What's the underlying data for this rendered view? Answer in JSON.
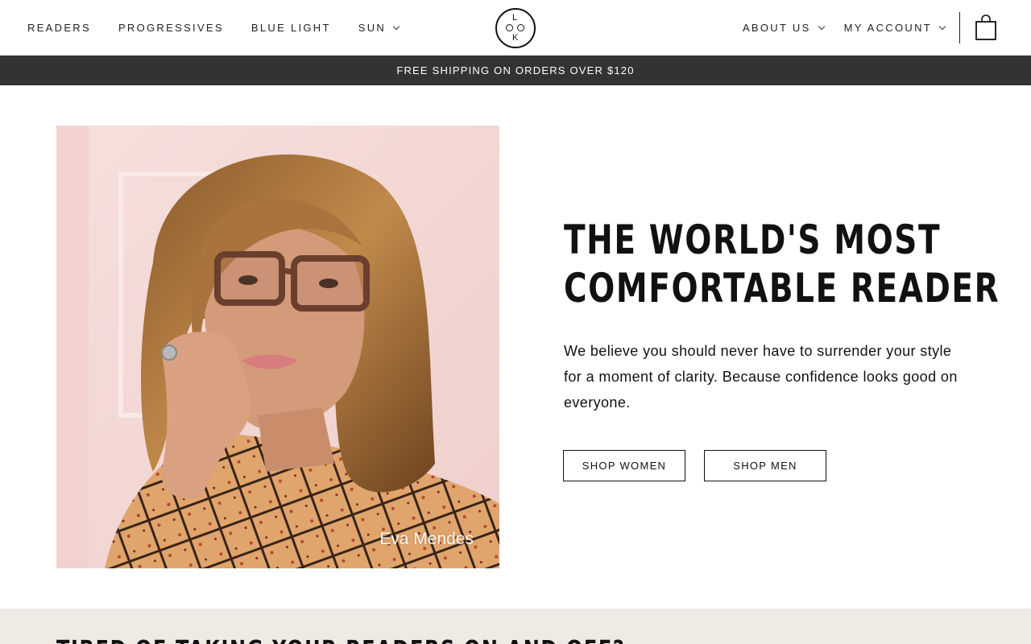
{
  "header": {
    "nav_left": [
      {
        "label": "READERS"
      },
      {
        "label": "PROGRESSIVES"
      },
      {
        "label": "BLUE LIGHT"
      },
      {
        "label": "SUN"
      }
    ],
    "nav_right": [
      {
        "label": "ABOUT US"
      },
      {
        "label": "MY ACCOUNT"
      }
    ],
    "logo_letters": "LOOK",
    "cart_icon": "shopping-bag-icon"
  },
  "banner": {
    "text": "FREE SHIPPING ON ORDERS OVER $120",
    "background": "#333333"
  },
  "hero": {
    "image_caption": "Eva Mendes",
    "title_line1": "THE WORLD'S MOST",
    "title_line2": "COMFORTABLE READER",
    "description": "We believe you should never have to surrender your style for a moment of clarity. Because confidence looks good on everyone.",
    "buttons": [
      {
        "label": "SHOP WOMEN"
      },
      {
        "label": "SHOP MEN"
      }
    ]
  },
  "section2": {
    "title": "TIRED OF TAKING YOUR READERS ON AND OFF?",
    "background": "#efebe4"
  }
}
